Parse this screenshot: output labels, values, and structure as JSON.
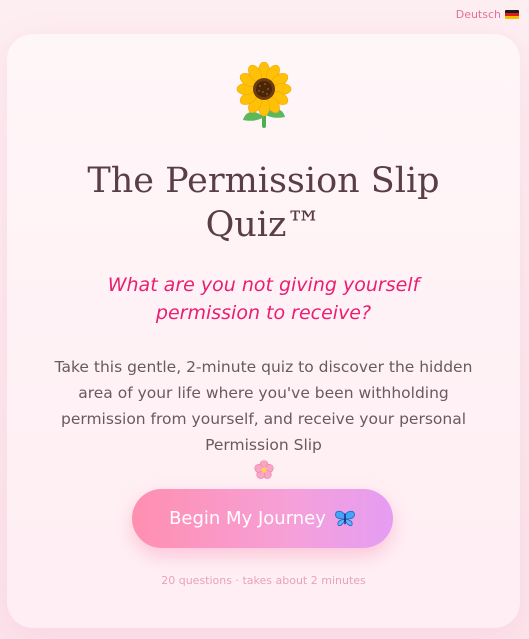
{
  "header": {
    "language_label": "Deutsch",
    "flag_icon": "german-flag-icon"
  },
  "hero": {
    "icon": "sunflower-icon",
    "title": "The Permission Slip Quiz™",
    "subtitle": "What are you not giving yourself permission to receive?",
    "description": "Take this gentle, 2-minute quiz to discover the hidden area of your life where you've been withholding permission from yourself, and receive your personal Permission Slip",
    "description_icon": "cherry-blossom-icon"
  },
  "cta": {
    "button_label": "Begin My Journey",
    "button_icon": "butterfly-icon",
    "meta_text": "20 questions · takes about 2 minutes"
  },
  "colors": {
    "accent": "#e91e72",
    "title": "#5a3e47",
    "button_start": "#ff8fb0",
    "button_end": "#e59df3",
    "background": "#fdeef2"
  }
}
